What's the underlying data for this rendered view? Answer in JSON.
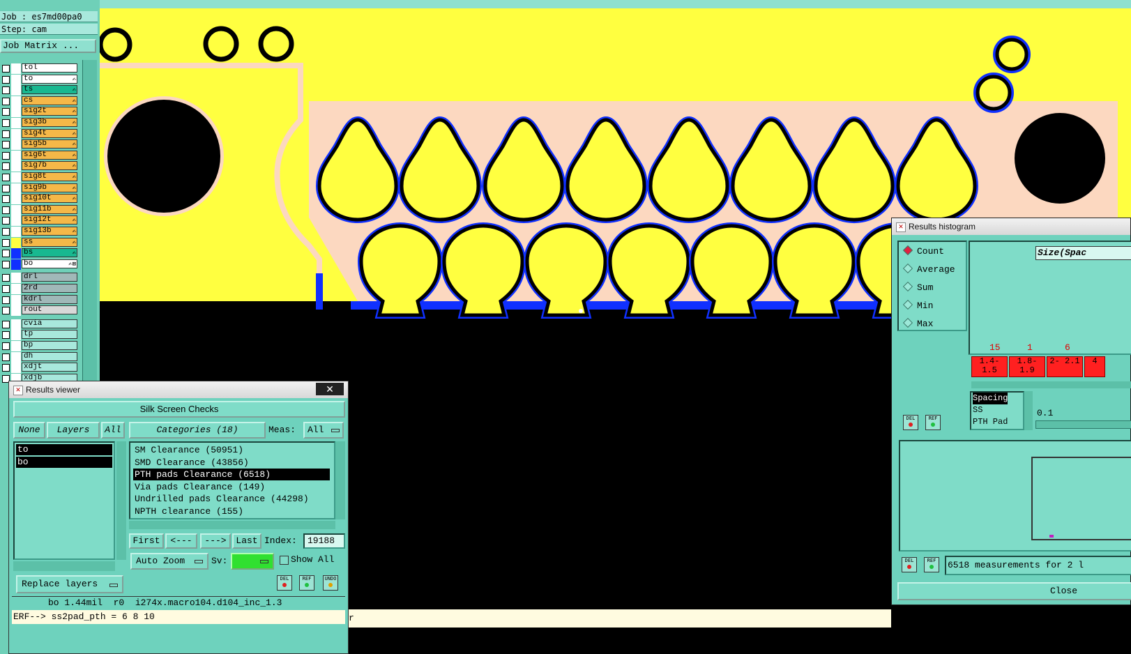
{
  "job": {
    "job_label": "Job : es7md00pa0",
    "step_label": "Step: cam",
    "matrix_button": "Job Matrix ..."
  },
  "layers": [
    {
      "name": "tol",
      "color": "#ffffff",
      "swatch": "#ffffff",
      "icon": ""
    },
    {
      "name": "to",
      "color": "#ffffff",
      "swatch": "#ffffff",
      "icon": "✍"
    },
    {
      "name": "ts",
      "color": "#18b890",
      "swatch": "#ffffff",
      "icon": "✍"
    },
    {
      "name": "cs",
      "color": "#f5b848",
      "swatch": "#ffffff",
      "icon": "✍"
    },
    {
      "name": "sig2t",
      "color": "#f5b848",
      "swatch": "#ffffff",
      "icon": "✍"
    },
    {
      "name": "sig3b",
      "color": "#f5b848",
      "swatch": "#ffffff",
      "icon": "✍"
    },
    {
      "name": "sig4t",
      "color": "#f5b848",
      "swatch": "#ffffff",
      "icon": "✍"
    },
    {
      "name": "sig5b",
      "color": "#f5b848",
      "swatch": "#ffffff",
      "icon": "✍"
    },
    {
      "name": "sig6t",
      "color": "#f5b848",
      "swatch": "#ffffff",
      "icon": "✍"
    },
    {
      "name": "sig7b",
      "color": "#f5b848",
      "swatch": "#ffffff",
      "icon": "✍"
    },
    {
      "name": "sig8t",
      "color": "#f5b848",
      "swatch": "#ffffff",
      "icon": "✍"
    },
    {
      "name": "sig9b",
      "color": "#f5b848",
      "swatch": "#ffffff",
      "icon": "✍"
    },
    {
      "name": "sig10t",
      "color": "#f5b848",
      "swatch": "#ffffff",
      "icon": "✍"
    },
    {
      "name": "sig11b",
      "color": "#f5b848",
      "swatch": "#ffffff",
      "icon": "✍"
    },
    {
      "name": "sig12t",
      "color": "#f5b848",
      "swatch": "#ffffff",
      "icon": "✍"
    },
    {
      "name": "sig13b",
      "color": "#f5b848",
      "swatch": "#ffffff",
      "icon": "✍"
    },
    {
      "name": "ss",
      "color": "#f5b848",
      "swatch": "#ffff40",
      "icon": "✍"
    },
    {
      "name": "bs",
      "color": "#18b890",
      "swatch": "#1030ff",
      "icon": "✍"
    },
    {
      "name": "bo",
      "color": "#ffffff",
      "swatch": "#1030ff",
      "icon": "✍⊠"
    },
    {
      "name": "drl",
      "color": "#a0b8b8",
      "swatch": "#ffffff",
      "icon": ""
    },
    {
      "name": "2rd",
      "color": "#a0b8b8",
      "swatch": "#ffffff",
      "icon": ""
    },
    {
      "name": "kdrl",
      "color": "#a0b8b8",
      "swatch": "#ffffff",
      "icon": ""
    },
    {
      "name": "rout",
      "color": "#d8d8d8",
      "swatch": "#ffffff",
      "icon": ""
    },
    {
      "name": "cvia",
      "color": "#a8e8dc",
      "swatch": "#ffffff",
      "icon": ""
    },
    {
      "name": "tp",
      "color": "#a8e8dc",
      "swatch": "#ffffff",
      "icon": ""
    },
    {
      "name": "bp",
      "color": "#a8e8dc",
      "swatch": "#ffffff",
      "icon": ""
    },
    {
      "name": "dh",
      "color": "#a8e8dc",
      "swatch": "#ffffff",
      "icon": ""
    },
    {
      "name": "xdjt",
      "color": "#a8e8dc",
      "swatch": "#ffffff",
      "icon": ""
    },
    {
      "name": "xdjb",
      "color": "#a8e8dc",
      "swatch": "#ffffff",
      "icon": ""
    }
  ],
  "results_viewer": {
    "title": "Results viewer",
    "heading": "Silk Screen Checks",
    "none_btn": "None",
    "layers_btn": "Layers",
    "all_btn": "All",
    "categories_btn": "Categories (18)",
    "meas_label": "Meas:",
    "meas_value": "All",
    "layer_list": [
      "to",
      "bo"
    ],
    "categories": [
      "SM Clearance (50951)",
      "SMD Clearance (43856)",
      "PTH pads Clearance (6518)",
      "Via pads Clearance (149)",
      "Undrilled pads Clearance (44298)",
      "NPTH clearance (155)"
    ],
    "selected_category": 2,
    "first_btn": "First",
    "prev_btn": "<---",
    "next_btn": "--->",
    "last_btn": "Last",
    "index_label": "Index:",
    "index_value": "19188",
    "zoom_option": "Auto Zoom",
    "sv_label": "Sv:",
    "show_all_label": "Show All",
    "replace_option": "Replace layers",
    "status_line": "bo 1.44mil  r0  i274x.macro104.d104_inc_1.3",
    "erf_line": "ERF--> ss2pad_pth = 6 8 10",
    "del_label": "DEL",
    "ref_label": "REF",
    "undo_label": "UNDO"
  },
  "histogram": {
    "title": "Results histogram",
    "modes": [
      "Count",
      "Average",
      "Sum",
      "Min",
      "Max"
    ],
    "selected_mode": "Count",
    "size_label": "Size(Spac",
    "bars": [
      {
        "count": "15",
        "range": "1.4- 1.5"
      },
      {
        "count": "1",
        "range": "1.8- 1.9"
      },
      {
        "count": "6",
        "range": "2- 2.1"
      },
      {
        "count": "",
        "range": "4"
      }
    ],
    "type_list": [
      "Spacing",
      "SS",
      "PTH Pad"
    ],
    "slider_value": "0.1",
    "summary": "6518 measurements for 2 l",
    "close_btn": "Close",
    "del_label": "DEL",
    "ref_label": "REF"
  },
  "cmdline_suffix": "r",
  "colors": {
    "board": "#ffff40",
    "soldermask": "#fcd8c0",
    "outline": "#1030ff",
    "panel": "#6ed2bd"
  }
}
